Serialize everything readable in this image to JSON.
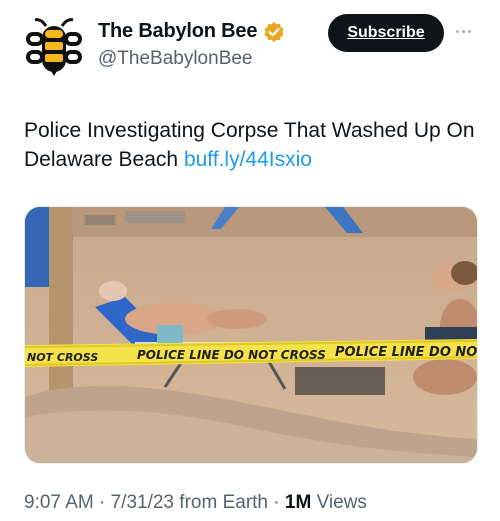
{
  "account": {
    "display_name": "The Babylon Bee",
    "handle": "@TheBabylonBee",
    "avatar_icon": "bee-logo-icon",
    "verified_icon": "gold-verified-badge-icon",
    "verified_color": "#e8a723"
  },
  "header": {
    "subscribe_label": "Subscribe",
    "more_icon": "more-options-icon"
  },
  "tweet": {
    "text": "Police Investigating Corpse That Washed Up On Delaware Beach",
    "link": "buff.ly/44Isxio"
  },
  "media": {
    "tape_text_left": "NOT CROSS",
    "tape_text_middle": "POLICE LINE DO NOT CROSS",
    "tape_text_right": "POLICE LINE DO NOT CROSS"
  },
  "meta": {
    "time": "9:07 AM",
    "date": "7/31/23",
    "source": "from Earth",
    "views_count": "1M",
    "views_label": "Views"
  },
  "colors": {
    "text_primary": "#0f1419",
    "text_secondary": "#536471",
    "link": "#1d9bf0",
    "button_bg": "#0f1419",
    "avatar_yellow": "#f4b81c"
  }
}
